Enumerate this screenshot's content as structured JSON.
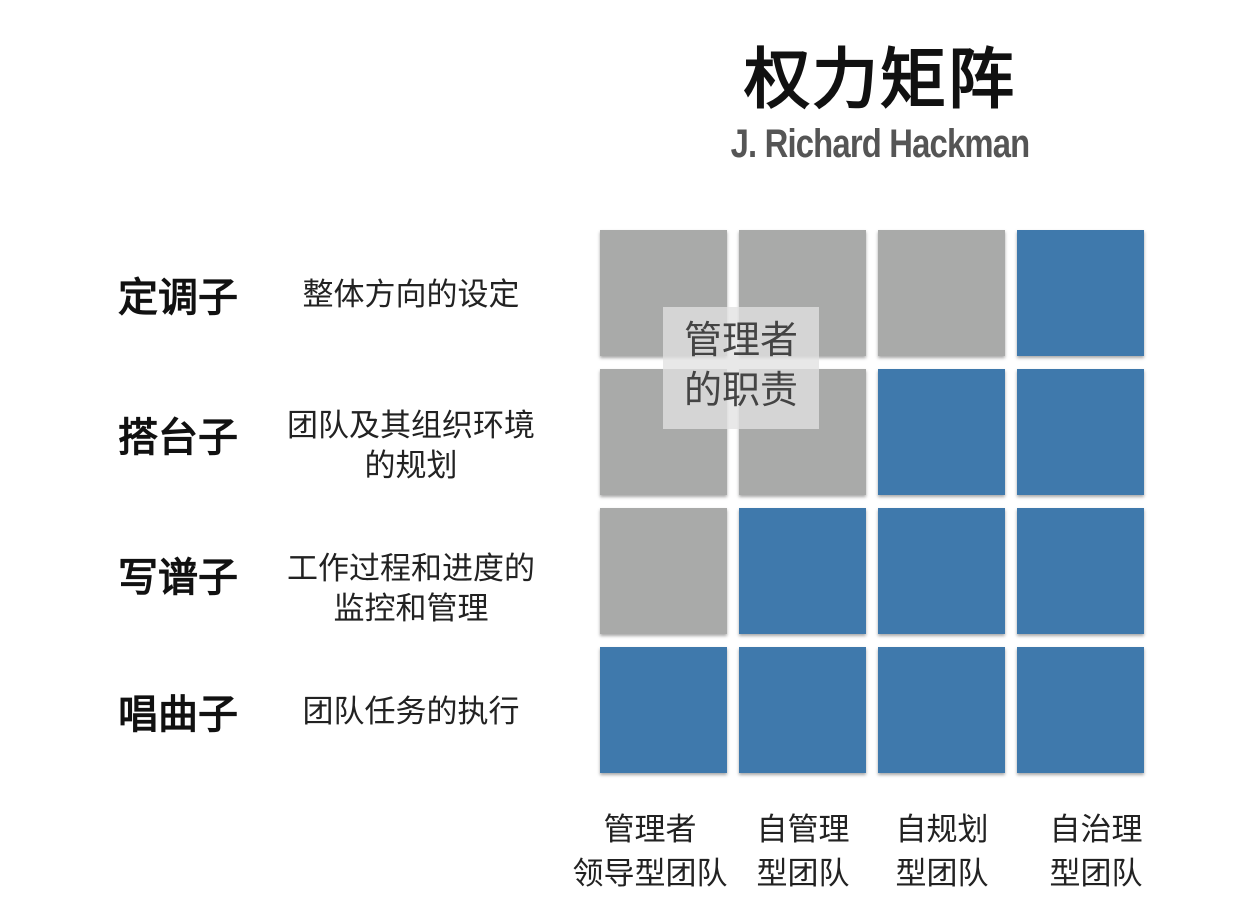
{
  "title": "权力矩阵",
  "subtitle": "J. Richard Hackman",
  "rows": [
    {
      "label": "定调子",
      "desc": [
        "整体方向的设定"
      ]
    },
    {
      "label": "搭台子",
      "desc": [
        "团队及其组织环境",
        "的规划"
      ]
    },
    {
      "label": "写谱子",
      "desc": [
        "工作过程和进度的",
        "监控和管理"
      ]
    },
    {
      "label": "唱曲子",
      "desc": [
        "团队任务的执行"
      ]
    }
  ],
  "columns": [
    {
      "line1": "管理者",
      "line2": "领导型团队"
    },
    {
      "line1": "自管理",
      "line2": "型团队"
    },
    {
      "line1": "自规划",
      "line2": "型团队"
    },
    {
      "line1": "自治理",
      "line2": "型团队"
    }
  ],
  "overlay": {
    "line1": "管理者",
    "line2": "的职责"
  },
  "colors": {
    "manager": "#a9aaa9",
    "team": "#3f79ac"
  },
  "matrix": [
    [
      "manager",
      "manager",
      "manager",
      "team"
    ],
    [
      "manager",
      "manager",
      "team",
      "team"
    ],
    [
      "manager",
      "team",
      "team",
      "team"
    ],
    [
      "team",
      "team",
      "team",
      "team"
    ]
  ]
}
